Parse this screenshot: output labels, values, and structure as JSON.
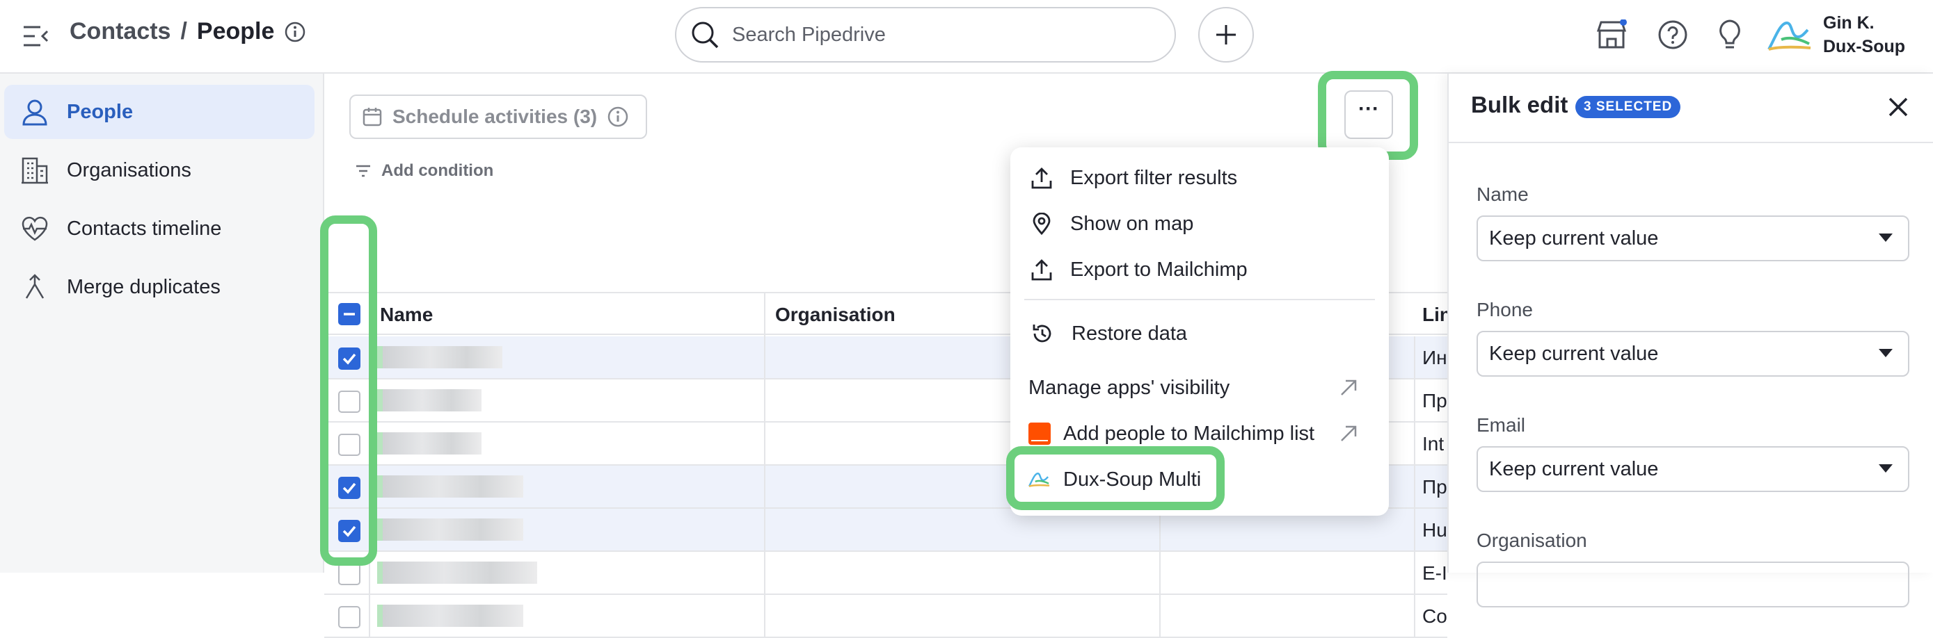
{
  "header": {
    "breadcrumb_parent": "Contacts",
    "breadcrumb_sep": "/",
    "breadcrumb_current": "People",
    "search_placeholder": "Search Pipedrive",
    "user_line1": "Gin K.",
    "user_line2": "Dux-Soup"
  },
  "sidebar": {
    "items": [
      {
        "label": "People",
        "icon": "person-icon",
        "active": true
      },
      {
        "label": "Organisations",
        "icon": "building-icon",
        "active": false
      },
      {
        "label": "Contacts timeline",
        "icon": "heart-pulse-icon",
        "active": false
      },
      {
        "label": "Merge duplicates",
        "icon": "merge-icon",
        "active": false
      }
    ]
  },
  "toolbar": {
    "schedule_label": "Schedule activities (3)",
    "add_condition_label": "Add condition",
    "more_label": "···"
  },
  "table": {
    "columns": [
      "Name",
      "Organisation",
      "Lin"
    ],
    "rows": [
      {
        "selected": true,
        "last": "Ин"
      },
      {
        "selected": false,
        "last": "Пр"
      },
      {
        "selected": false,
        "last": "Int"
      },
      {
        "selected": true,
        "last": "Пр"
      },
      {
        "selected": true,
        "last": "Hu"
      },
      {
        "selected": false,
        "last": "E-I"
      },
      {
        "selected": false,
        "last": "Co"
      }
    ]
  },
  "menu": {
    "items": [
      {
        "label": "Export filter results",
        "icon": "upload-icon"
      },
      {
        "label": "Show on map",
        "icon": "map-pin-icon"
      },
      {
        "label": "Export to Mailchimp",
        "icon": "upload-icon"
      },
      {
        "label": "Restore data",
        "icon": "restore-icon"
      },
      {
        "label": "Manage apps' visibility",
        "icon": "external-arrow-icon"
      },
      {
        "label": "Add people to Mailchimp list",
        "icon": "zapier-icon"
      },
      {
        "label": "Dux-Soup Multi",
        "icon": "dux-soup-icon"
      }
    ]
  },
  "panel": {
    "title": "Bulk edit",
    "badge": "3 SELECTED",
    "fields": [
      {
        "label": "Name",
        "value": "Keep current value"
      },
      {
        "label": "Phone",
        "value": "Keep current value"
      },
      {
        "label": "Email",
        "value": "Keep current value"
      },
      {
        "label": "Organisation",
        "value": ""
      }
    ]
  },
  "colors": {
    "accent": "#2c66d8",
    "highlight": "#6ccf7d",
    "active_bg": "#e5ecfb"
  }
}
